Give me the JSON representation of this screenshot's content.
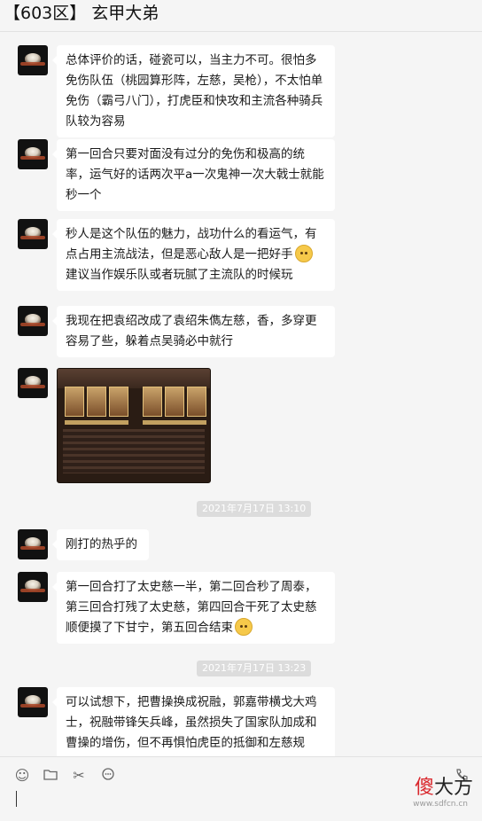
{
  "window": {
    "title": "【603区】 玄甲大弟"
  },
  "messages": [
    {
      "type": "text",
      "text": "总体评价的话，碰瓷可以，当主力不可。很怕多免伤队伍（桃园算形阵，左慈，吴枪），不太怕单免伤（霸弓八门），打虎臣和快攻和主流各种骑兵队较为容易"
    },
    {
      "type": "text",
      "text": "第一回合只要对面没有过分的免伤和极高的统率，运气好的话两次平a一次鬼神一次大戟士就能秒一个"
    },
    {
      "type": "text",
      "line1": "秒人是这个队伍的魅力，战功什么的看运气，有点占用主流战法，但是恶心敌人是一把好手",
      "line2": "建议当作娱乐队或者玩腻了主流队的时候玩",
      "emoji": "smile-emoji"
    },
    {
      "type": "text",
      "text": "我现在把袁绍改成了袁绍朱儁左慈，香，多穿更容易了些，躲着点吴骑必中就行"
    },
    {
      "type": "image",
      "alt": "game battle screenshot"
    },
    {
      "type": "timestamp",
      "text": "2021年7月17日 13:10"
    },
    {
      "type": "text",
      "text": "刚打的热乎的"
    },
    {
      "type": "text",
      "text": "第一回合打了太史慈一半，第二回合秒了周泰，第三回合打残了太史慈，第四回合干死了太史慈顺便摸了下甘宁，第五回合结束",
      "emoji": "thinking-emoji"
    },
    {
      "type": "timestamp",
      "text": "2021年7月17日 13:23"
    },
    {
      "type": "text",
      "text": "可以试想下，把曹操换成祝融，郭嘉带横戈大鸡士，祝融带锋矢兵峰，虽然损失了国家队加成和曹操的增伤，但不再惧怕虎臣的抵御和左慈规避，加上第二回合郭嘉免伤消失后祝融的穿盾过渡"
    }
  ],
  "toolbar": {
    "icons": [
      "emoji-icon",
      "folder-icon",
      "scissors-icon",
      "chat-bubble-icon",
      "phone-icon"
    ],
    "watermark_main": "傻",
    "watermark_rest": "大方",
    "watermark_sub": "www.sdfcn.cn"
  },
  "colors": {
    "bubble": "#ffffff",
    "background": "#f5f5f5",
    "timestamp_bg": "#dcdcdc",
    "watermark_red": "#d9262c"
  }
}
